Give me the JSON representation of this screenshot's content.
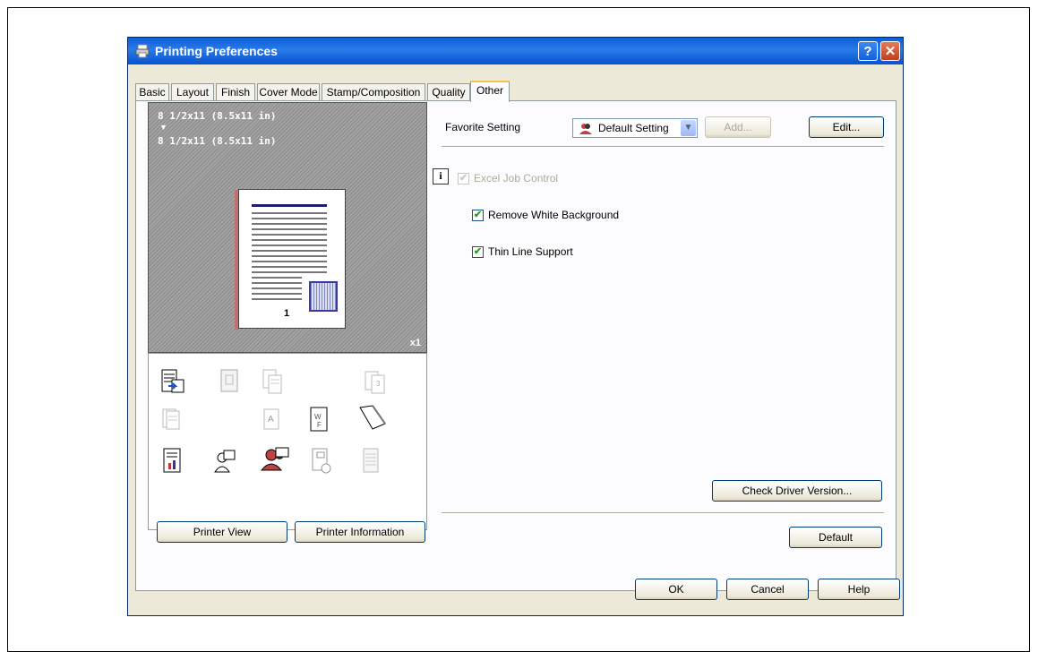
{
  "window": {
    "title": "Printing Preferences",
    "help_glyph": "?",
    "close_glyph": "✕"
  },
  "tabs": [
    {
      "label": "Basic"
    },
    {
      "label": "Layout"
    },
    {
      "label": "Finish"
    },
    {
      "label": "Cover Mode"
    },
    {
      "label": "Stamp/Composition"
    },
    {
      "label": "Quality"
    },
    {
      "label": "Other",
      "active": true
    }
  ],
  "preview": {
    "paper_line1": "8 1/2x11 (8.5x11 in)",
    "arrow": "▼",
    "paper_line2": "8 1/2x11 (8.5x11 in)",
    "page_number": "1",
    "copies": "x1"
  },
  "left_buttons": {
    "printer_view": "Printer View",
    "printer_information": "Printer Information"
  },
  "favorite": {
    "label": "Favorite Setting",
    "value": "Default Setting",
    "add": "Add...",
    "edit": "Edit..."
  },
  "options": {
    "excel_job_control": {
      "label": "Excel Job Control",
      "checked": true,
      "enabled": false
    },
    "remove_white_background": {
      "label": "Remove White Background",
      "checked": true,
      "enabled": true
    },
    "thin_line_support": {
      "label": "Thin Line Support",
      "checked": true,
      "enabled": true
    }
  },
  "info_glyph": "i",
  "check_glyph": "✔",
  "check_driver_version": "Check Driver Version...",
  "default_button": "Default",
  "footer": {
    "ok": "OK",
    "cancel": "Cancel",
    "help": "Help"
  },
  "colors": {
    "title_bar": "#0a5fd8",
    "dialog_bg": "#ece9d8",
    "active_tab_accent": "#f6bf4f",
    "checkmark": "#21a121"
  }
}
